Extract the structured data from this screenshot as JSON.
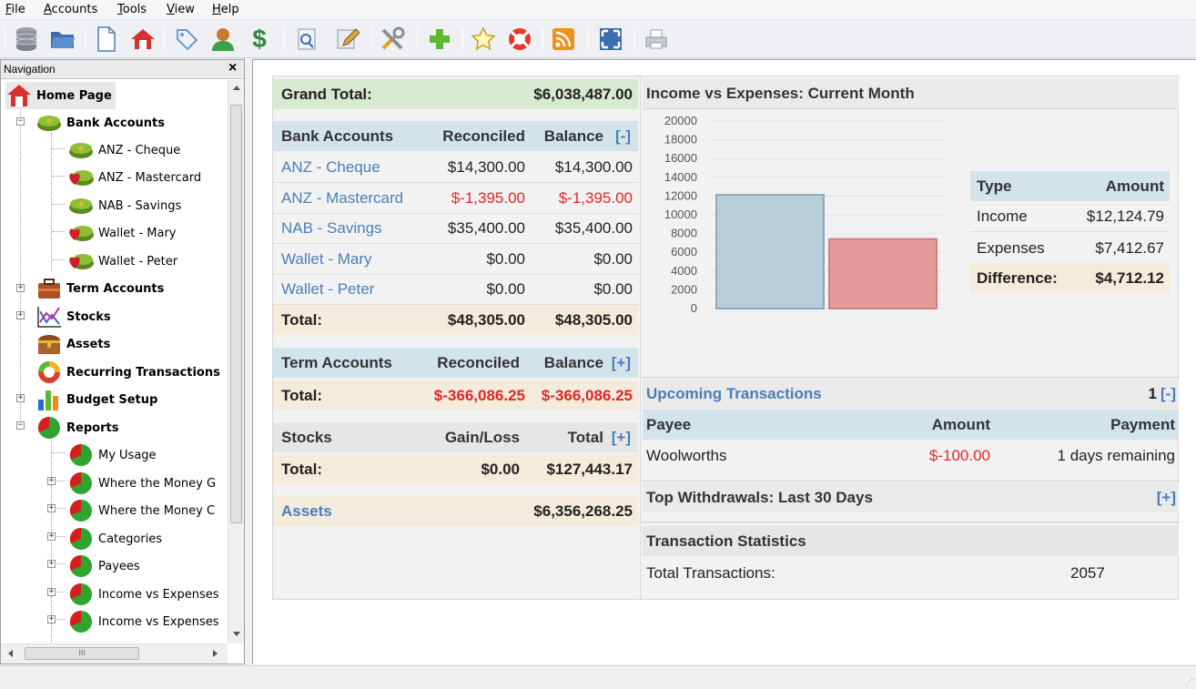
{
  "menu": [
    "File",
    "Accounts",
    "Tools",
    "View",
    "Help"
  ],
  "toolbar": {
    "icons": [
      "database-icon",
      "folder-open-icon",
      "new-document-icon",
      "home-icon",
      "tag-icon",
      "user-icon",
      "dollar-icon",
      "print-preview-icon",
      "edit-icon",
      "tools-icon",
      "add-icon",
      "star-icon",
      "help-icon",
      "rss-icon",
      "fullscreen-icon",
      "printer-icon"
    ],
    "dollar": "$"
  },
  "nav": {
    "title": "Navigation",
    "close": "×",
    "items": [
      {
        "label": "Home Page",
        "icon": "home-icon"
      },
      {
        "label": "Bank Accounts",
        "icon": "money-icon"
      },
      {
        "label": "ANZ - Cheque",
        "icon": "money-icon"
      },
      {
        "label": "ANZ - Mastercard",
        "icon": "money-heart-icon"
      },
      {
        "label": "NAB - Savings",
        "icon": "money-icon"
      },
      {
        "label": "Wallet - Mary",
        "icon": "money-heart-icon"
      },
      {
        "label": "Wallet - Peter",
        "icon": "money-heart-icon"
      },
      {
        "label": "Term Accounts",
        "icon": "briefcase-icon"
      },
      {
        "label": "Stocks",
        "icon": "stocks-chart-icon"
      },
      {
        "label": "Assets",
        "icon": "treasure-chest-icon"
      },
      {
        "label": "Recurring Transactions",
        "icon": "recurring-icon"
      },
      {
        "label": "Budget Setup",
        "icon": "bar-chart-icon"
      },
      {
        "label": "Reports",
        "icon": "pie-chart-icon"
      },
      {
        "label": "My Usage",
        "icon": "pie-chart-icon"
      },
      {
        "label": "Where the Money G",
        "icon": "pie-chart-icon"
      },
      {
        "label": "Where the Money C",
        "icon": "pie-chart-icon"
      },
      {
        "label": "Categories",
        "icon": "pie-chart-icon"
      },
      {
        "label": "Payees",
        "icon": "pie-chart-icon"
      },
      {
        "label": "Income vs Expenses",
        "icon": "pie-chart-icon"
      },
      {
        "label": "Income vs Expenses",
        "icon": "pie-chart-icon"
      }
    ],
    "hscroll_thumb": "III"
  },
  "grand_total": {
    "label": "Grand Total:",
    "value": "$6,038,487.00"
  },
  "bank": {
    "headers": [
      "Bank Accounts",
      "Reconciled",
      "Balance",
      "[-]"
    ],
    "rows": [
      {
        "name": "ANZ - Cheque",
        "reconciled": "$14,300.00",
        "balance": "$14,300.00",
        "negative": false
      },
      {
        "name": "ANZ - Mastercard",
        "reconciled": "$-1,395.00",
        "balance": "$-1,395.00",
        "negative": true
      },
      {
        "name": "NAB - Savings",
        "reconciled": "$35,400.00",
        "balance": "$35,400.00",
        "negative": false
      },
      {
        "name": "Wallet - Mary",
        "reconciled": "$0.00",
        "balance": "$0.00",
        "negative": false
      },
      {
        "name": "Wallet - Peter",
        "reconciled": "$0.00",
        "balance": "$0.00",
        "negative": false
      }
    ],
    "total": {
      "label": "Total:",
      "reconciled": "$48,305.00",
      "balance": "$48,305.00"
    }
  },
  "term": {
    "headers": [
      "Term Accounts",
      "Reconciled",
      "Balance",
      "[+]"
    ],
    "total": {
      "label": "Total:",
      "reconciled": "$-366,086.25",
      "balance": "$-366,086.25"
    }
  },
  "stocks": {
    "headers": [
      "Stocks",
      "Gain/Loss",
      "Total",
      "[+]"
    ],
    "total": {
      "label": "Total:",
      "gain": "$0.00",
      "total": "$127,443.17"
    }
  },
  "assets": {
    "label": "Assets",
    "value": "$6,356,268.25"
  },
  "income_expenses": {
    "title": "Income vs Expenses: Current Month",
    "table": {
      "headers": [
        "Type",
        "Amount"
      ],
      "rows": [
        {
          "type": "Income",
          "amount": "$12,124.79"
        },
        {
          "type": "Expenses",
          "amount": "$7,412.67"
        }
      ],
      "diff": {
        "type": "Difference:",
        "amount": "$4,712.12"
      }
    }
  },
  "chart_data": {
    "type": "bar",
    "title": "",
    "categories": [
      "Income",
      "Expenses"
    ],
    "values": [
      12124.79,
      7412.67
    ],
    "colors": [
      "#b8cedb",
      "#e59a9a"
    ],
    "ylim": [
      0,
      20000
    ],
    "yticks": [
      "20000",
      "18000",
      "16000",
      "14000",
      "12000",
      "10000",
      "8000",
      "6000",
      "4000",
      "2000",
      "0"
    ],
    "grid": true
  },
  "upcoming": {
    "title": "Upcoming Transactions",
    "count": "1",
    "toggle": "[-]",
    "headers": [
      "Payee",
      "Amount",
      "Payment"
    ],
    "rows": [
      {
        "payee": "Woolworths",
        "amount": "$-100.00",
        "payment": "1 days remaining"
      }
    ]
  },
  "top_withdrawals": {
    "title": "Top Withdrawals: Last 30 Days",
    "toggle": "[+]"
  },
  "stats": {
    "title": "Transaction Statistics",
    "label": "Total Transactions:",
    "value": "2057"
  }
}
